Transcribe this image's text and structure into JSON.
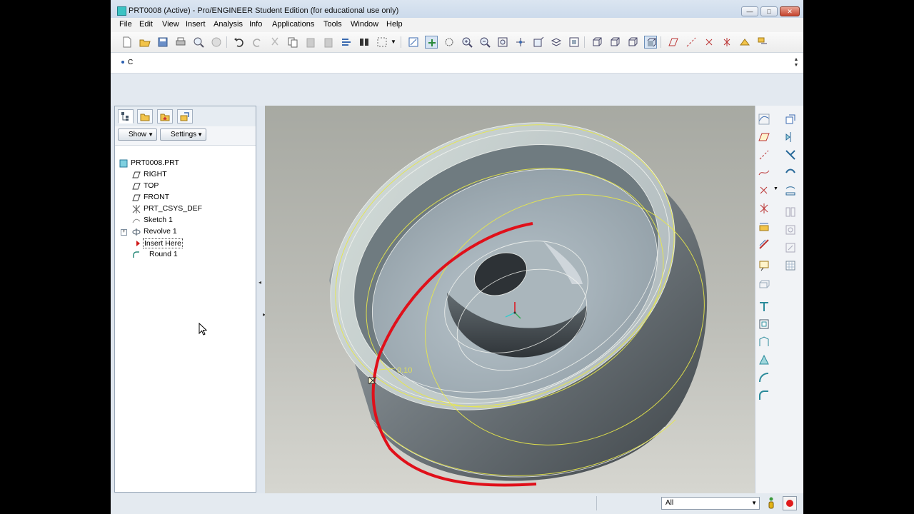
{
  "window": {
    "title": "PRT0008 (Active) - Pro/ENGINEER Student Edition (for educational use only)",
    "min_glyph": "—",
    "max_glyph": "□",
    "close_glyph": "✕"
  },
  "menu": {
    "items": [
      "File",
      "Edit",
      "View",
      "Insert",
      "Analysis",
      "Info",
      "Applications",
      "Tools",
      "Window",
      "Help"
    ]
  },
  "message_area": {
    "text": "C"
  },
  "navigator": {
    "show_label": "Show",
    "settings_label": "Settings",
    "tree": [
      {
        "label": "PRT0008.PRT",
        "icon": "part-icon"
      },
      {
        "label": "RIGHT",
        "icon": "datum-plane-icon"
      },
      {
        "label": "TOP",
        "icon": "datum-plane-icon"
      },
      {
        "label": "FRONT",
        "icon": "datum-plane-icon"
      },
      {
        "label": "PRT_CSYS_DEF",
        "icon": "csys-icon"
      },
      {
        "label": "Sketch 1",
        "icon": "sketch-icon"
      },
      {
        "label": "Revolve 1",
        "icon": "revolve-icon",
        "expander": "+"
      },
      {
        "label": "Insert Here",
        "icon": "insert-arrow-icon"
      },
      {
        "label": "Round 1",
        "icon": "round-icon"
      }
    ]
  },
  "viewport": {
    "dimension_label": "0.10"
  },
  "status": {
    "filter_value": "All"
  },
  "colors": {
    "selection_red": "#e0101a",
    "wire_yellow": "#e8e84a",
    "model_gray": "#8c9499"
  }
}
